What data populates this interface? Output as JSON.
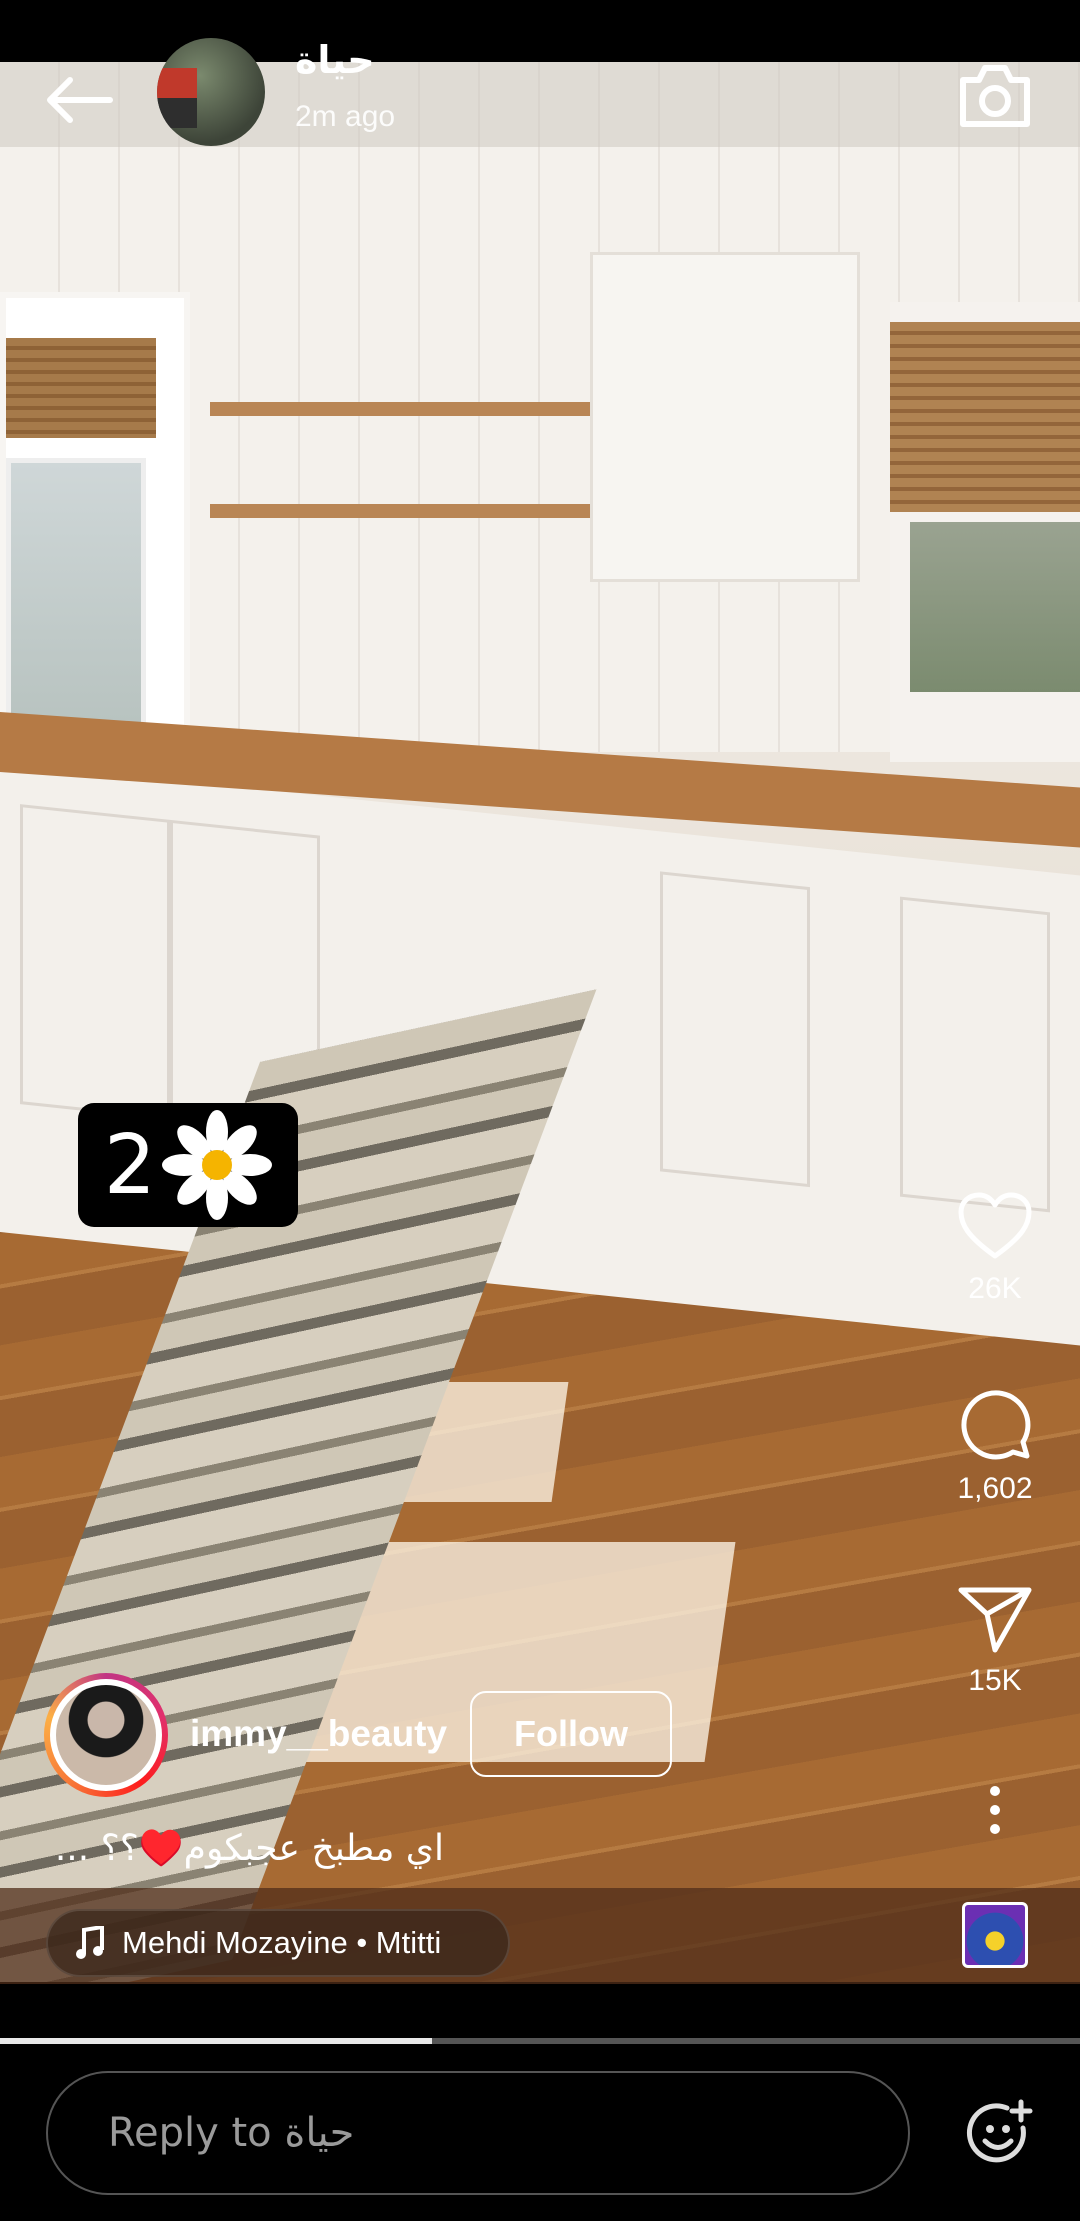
{
  "header": {
    "username": "حياة",
    "timestamp": "2m ago"
  },
  "sticker": {
    "number": "2",
    "icon": "daisy-icon"
  },
  "actions": {
    "likes": "26K",
    "comments": "1,602",
    "shares": "15K"
  },
  "author": {
    "username": "immy__beauty",
    "follow_label": "Follow"
  },
  "caption": "اي مطبخ عجبكوم♥️؟؟ ...",
  "music": {
    "track": "Mehdi Mozayine • Mtitti"
  },
  "progress": {
    "fraction": 0.4
  },
  "reply": {
    "placeholder": "Reply to حياة"
  },
  "colors": {
    "accent": "#ffffff",
    "heart": "#e8304f"
  }
}
